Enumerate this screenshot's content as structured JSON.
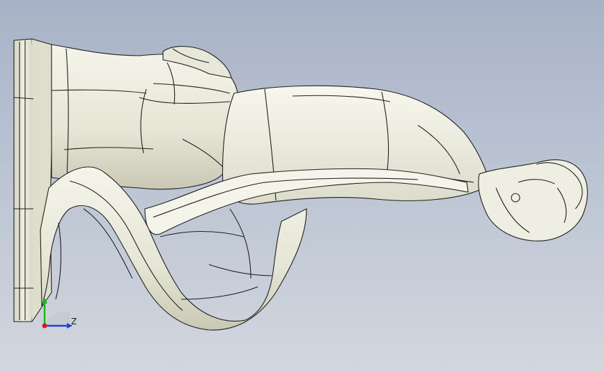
{
  "viewport": {
    "background_top": "#a8b2c6",
    "background_bottom": "#d2d6de"
  },
  "model": {
    "fill_color": "#ececdf",
    "shade_color": "#c9c9b6",
    "edge_color": "#1e1e1e"
  },
  "triad": {
    "z_label": "Z",
    "y_label": "",
    "z_color": "#1f3fd8",
    "y_color": "#14b814",
    "x_color": "#d81a1a"
  }
}
